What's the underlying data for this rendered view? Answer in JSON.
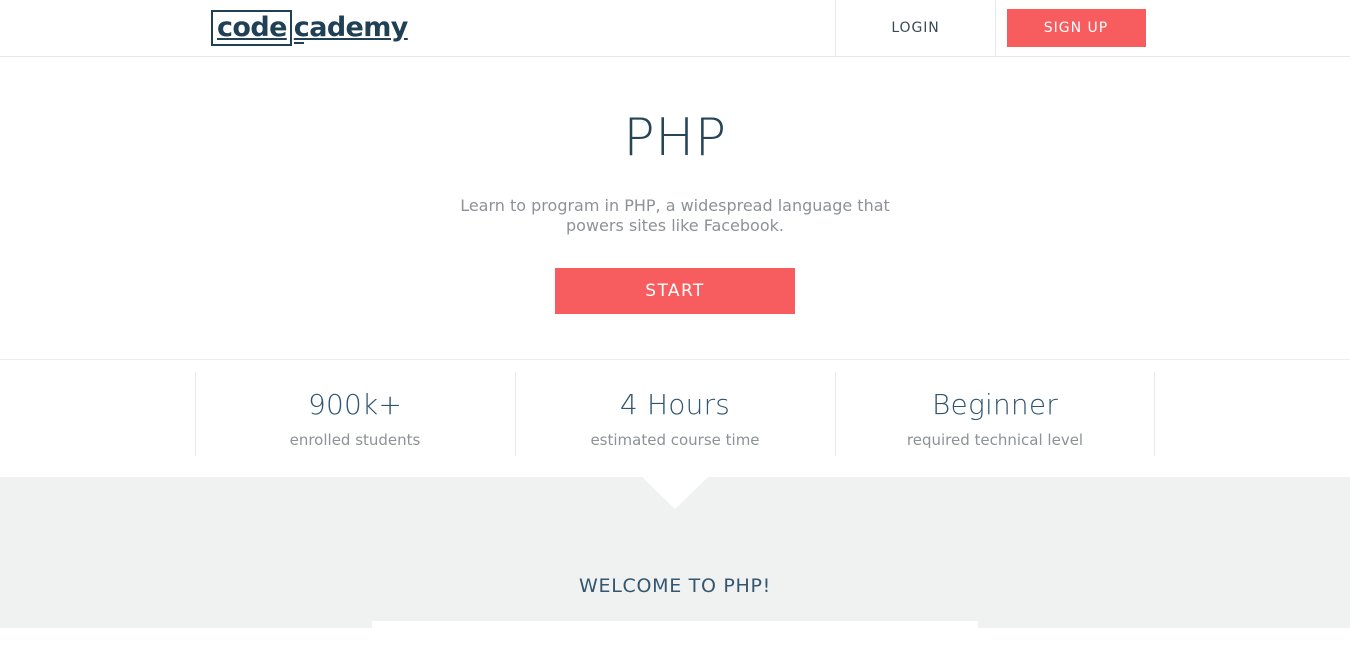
{
  "header": {
    "logo": {
      "boxed_text": "code",
      "rest_text": "cademy",
      "icon": "codecademy-logo"
    },
    "login_label": "LOGIN",
    "signup_label": "SIGN UP"
  },
  "hero": {
    "title": "PHP",
    "subtitle": "Learn to program in PHP, a widespread language that powers sites like Facebook.",
    "start_label": "START"
  },
  "stats": [
    {
      "value": "900k+",
      "label": "enrolled students"
    },
    {
      "value": "4 Hours",
      "label": "estimated course time"
    },
    {
      "value": "Beginner",
      "label": "required technical level"
    }
  ],
  "lesson_section": {
    "welcome_heading": "WELCOME TO PHP!"
  },
  "colors": {
    "accent": "#f75c5f",
    "navy": "#274559",
    "muted_text": "#8d9298",
    "gray_bg": "#f0f1f1",
    "border": "#e6e8e9"
  }
}
